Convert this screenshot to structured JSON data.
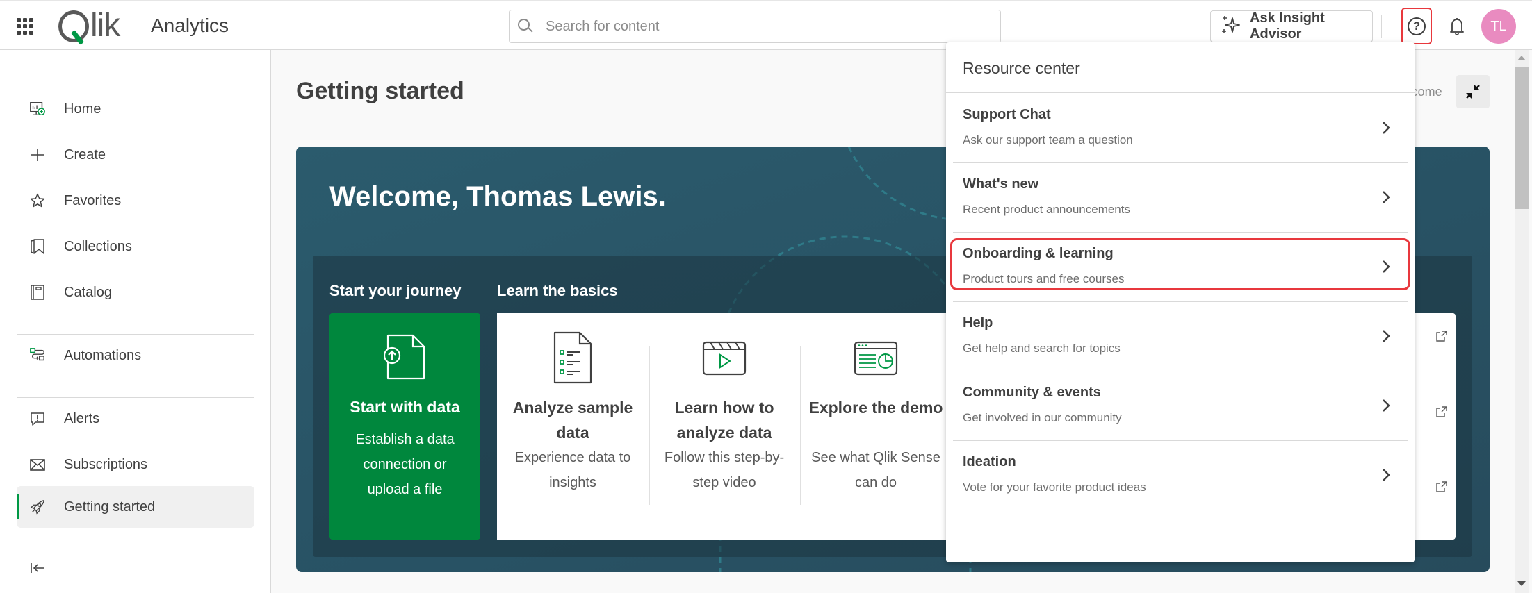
{
  "header": {
    "app_name": "Analytics",
    "logo_text": "lik",
    "search_placeholder": "Search for content",
    "search_value": "",
    "insight_button": "Ask Insight Advisor",
    "avatar_initials": "TL",
    "avatar_color": "#e98bc0"
  },
  "sidebar": {
    "items": [
      {
        "label": "Home",
        "icon": "home-monitor-icon"
      },
      {
        "label": "Create",
        "icon": "plus-icon"
      },
      {
        "label": "Favorites",
        "icon": "star-icon"
      },
      {
        "label": "Collections",
        "icon": "bookmark-icon"
      },
      {
        "label": "Catalog",
        "icon": "catalog-icon"
      },
      {
        "label": "Automations",
        "icon": "automation-icon"
      },
      {
        "label": "Alerts",
        "icon": "alert-icon"
      },
      {
        "label": "Subscriptions",
        "icon": "envelope-icon"
      },
      {
        "label": "Getting started",
        "icon": "rocket-icon",
        "active": true
      }
    ],
    "collapse_icon": "collapse-left-icon"
  },
  "main": {
    "page_title": "Getting started",
    "welcome_toggle_label": "Welcome",
    "banner": {
      "welcome": "Welcome, Thomas Lewis.",
      "tabs": [
        "Start your journey",
        "Learn the basics"
      ],
      "start_card": {
        "title": "Start with data",
        "description": "Establish a data connection or upload a file"
      },
      "features": [
        {
          "title": "Analyze sample data",
          "description": "Experience data to insights"
        },
        {
          "title": "Learn how to analyze data",
          "description": "Follow this step-by-step video"
        },
        {
          "title": "Explore the demo",
          "description": "See what Qlik Sense can do"
        }
      ]
    }
  },
  "resource_center": {
    "title": "Resource center",
    "items": [
      {
        "title": "Support Chat",
        "subtitle": "Ask our support team a question"
      },
      {
        "title": "What's new",
        "subtitle": "Recent product announcements"
      },
      {
        "title": "Onboarding & learning",
        "subtitle": "Product tours and free courses",
        "highlighted": true
      },
      {
        "title": "Help",
        "subtitle": "Get help and search for topics"
      },
      {
        "title": "Community & events",
        "subtitle": "Get involved in our community"
      },
      {
        "title": "Ideation",
        "subtitle": "Vote for your favorite product ideas"
      }
    ]
  },
  "colors": {
    "brand_green": "#009845",
    "start_card_green": "#00873d",
    "banner_teal": "#2b5b6d",
    "highlight_red": "#e8383d"
  }
}
